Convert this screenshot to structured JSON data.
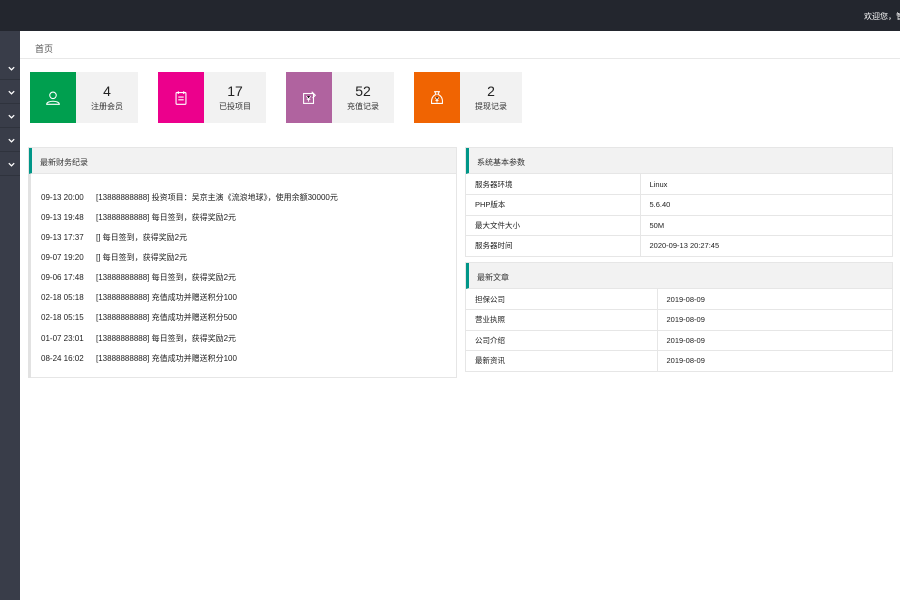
{
  "topbar": {
    "welcome": "欢迎您，管"
  },
  "breadcrumb": {
    "home": "首页"
  },
  "stats": [
    {
      "value": "4",
      "label": "注册会员",
      "color": "#009f4f",
      "icon": "user-icon"
    },
    {
      "value": "17",
      "label": "已投项目",
      "color": "#ec008c",
      "icon": "clipboard-icon"
    },
    {
      "value": "52",
      "label": "充值记录",
      "color": "#b0639f",
      "icon": "recharge-icon"
    },
    {
      "value": "2",
      "label": "提现记录",
      "color": "#f06402",
      "icon": "money-bag-icon"
    }
  ],
  "finance": {
    "title": "最新财务纪录",
    "records": [
      {
        "time": "09-13 20:00",
        "text": "[13888888888] 投资项目：吴京主演《流浪地球》，使用余额30000元"
      },
      {
        "time": "09-13 19:48",
        "text": "[13888888888] 每日签到，获得奖励2元"
      },
      {
        "time": "09-13 17:37",
        "text": "[] 每日签到，获得奖励2元"
      },
      {
        "time": "09-07 19:20",
        "text": "[] 每日签到，获得奖励2元"
      },
      {
        "time": "09-06 17:48",
        "text": "[13888888888] 每日签到，获得奖励2元"
      },
      {
        "time": "02-18 05:18",
        "text": "[13888888888] 充值成功并赠送积分100"
      },
      {
        "time": "02-18 05:15",
        "text": "[13888888888] 充值成功并赠送积分500"
      },
      {
        "time": "01-07 23:01",
        "text": "[13888888888] 每日签到，获得奖励2元"
      },
      {
        "time": "08-24 16:02",
        "text": "[13888888888] 充值成功并赠送积分100"
      }
    ]
  },
  "system": {
    "title": "系统基本参数",
    "rows": [
      {
        "key": "服务器环境",
        "value": "Linux"
      },
      {
        "key": "PHP版本",
        "value": "5.6.40"
      },
      {
        "key": "最大文件大小",
        "value": "50M"
      },
      {
        "key": "服务器时间",
        "value": "2020-09-13 20:27:45"
      }
    ]
  },
  "articles": {
    "title": "最新文章",
    "rows": [
      {
        "key": "担保公司",
        "value": "2019-08-09"
      },
      {
        "key": "营业执照",
        "value": "2019-08-09"
      },
      {
        "key": "公司介绍",
        "value": "2019-08-09"
      },
      {
        "key": "最新资讯",
        "value": "2019-08-09"
      }
    ]
  }
}
